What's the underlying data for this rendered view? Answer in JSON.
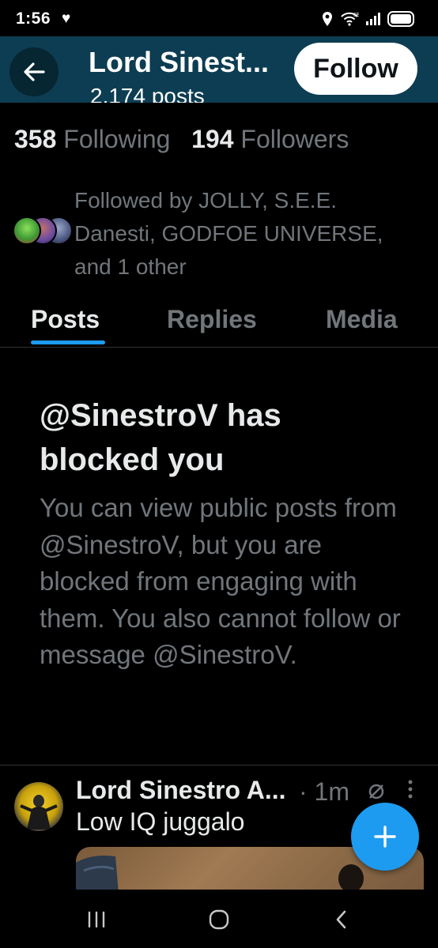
{
  "status_bar": {
    "time": "1:56",
    "network": "6E",
    "icons": [
      "heart-icon",
      "location-icon",
      "wifi-icon",
      "signal-icon",
      "battery-icon"
    ]
  },
  "header": {
    "title": "Lord Sinest...",
    "subtitle": "2,174 posts",
    "follow_label": "Follow",
    "background_color": "#0d3d52"
  },
  "stats": {
    "following_count": "358",
    "following_label": "Following",
    "followers_count": "194",
    "followers_label": "Followers"
  },
  "followed_by": {
    "text": "Followed by JOLLY, S.E.E. Danesti, GODFOE UNIVERSE, and 1 other"
  },
  "tabs": [
    {
      "label": "Posts",
      "active": true
    },
    {
      "label": "Replies",
      "active": false
    },
    {
      "label": "Media",
      "active": false
    }
  ],
  "blocked": {
    "title": "@SinestroV has blocked you",
    "body": "You can view public posts from @SinestroV, but you are blocked from engaging with them. You also cannot follow or message @SinestroV."
  },
  "post": {
    "author": "Lord Sinestro A...",
    "meta": "· 1m",
    "text": "Low IQ juggalo"
  },
  "colors": {
    "accent": "#1d9bf0",
    "text_primary": "#e7e9ea",
    "text_secondary": "#71767b",
    "divider": "#2f3336"
  }
}
